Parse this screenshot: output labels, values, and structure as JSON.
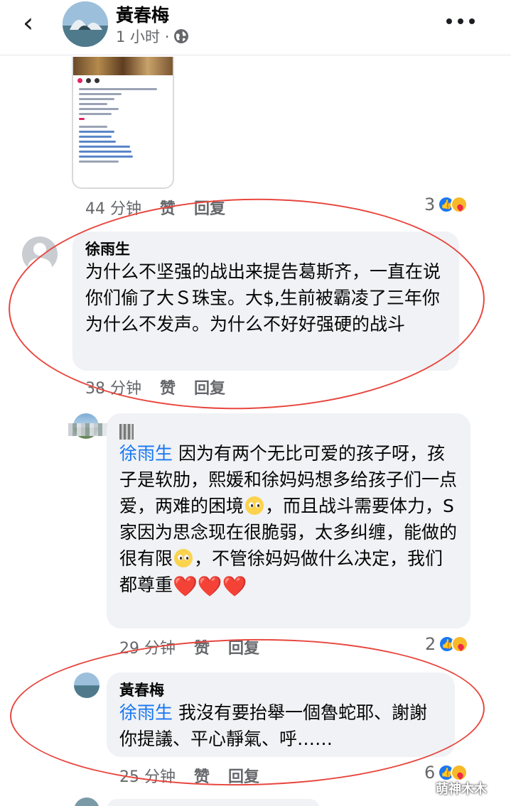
{
  "header": {
    "title": "黃春梅",
    "time": "1 小时 ·",
    "back_icon": "chevron-left-icon",
    "privacy_icon": "globe-icon",
    "menu_icon": "more-horizontal-icon"
  },
  "post_reaction": {
    "time": "44 分钟",
    "like_label": "赞",
    "reply_label": "回复",
    "reaction_count": "3"
  },
  "comments": [
    {
      "author": "徐雨生",
      "text": "为什么不坚强的战出来提告葛斯齐，一直在说你们偷了大Ｓ珠宝。大$,生前被霸凌了三年你为什么不发声。为什么不好好强硬的战斗",
      "time": "38 分钟",
      "like_label": "赞",
      "reply_label": "回复"
    },
    {
      "author": "",
      "mention": "徐雨生",
      "text_1": " 因为有两个无比可爱的孩子呀，孩子是软肋，熙媛和徐妈妈想多给孩子们一点爱，两难的困境",
      "text_2": "，而且战斗需要体力，S家因为思念现在很脆弱，太多纠缠，能做的很有限",
      "text_3": "，不管徐妈妈做什么决定，我们都尊重",
      "time": "29 分钟",
      "like_label": "赞",
      "reply_label": "回复",
      "reaction_count": "2"
    },
    {
      "author": "黃春梅",
      "mention": "徐雨生",
      "text": " 我沒有要抬舉一個魯蛇耶、謝謝你提議、平心靜氣、呼……",
      "time": "25 分钟",
      "like_label": "赞",
      "reply_label": "回复",
      "reaction_count": "6"
    }
  ],
  "watermark": "萌神木木",
  "colors": {
    "mention": "#1877f2",
    "bubble": "#f0f2f5",
    "annotation": "#e8463e",
    "like": "#1877f2",
    "heart": "#e3132b"
  }
}
